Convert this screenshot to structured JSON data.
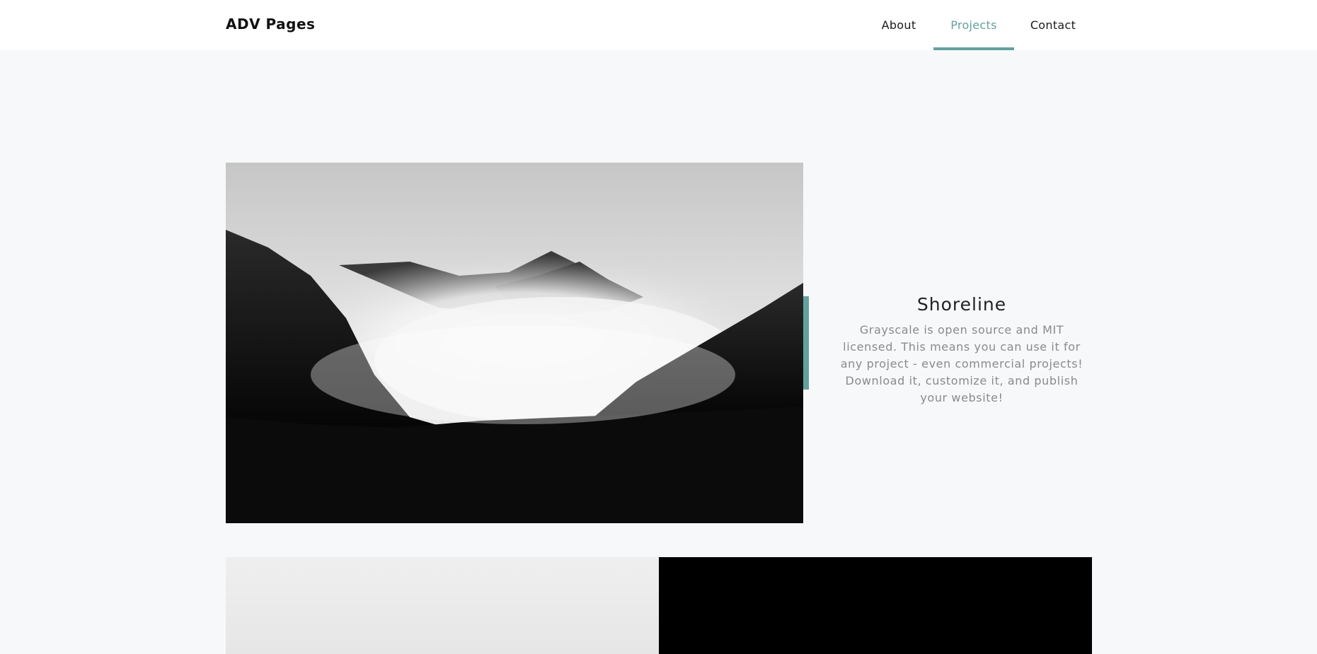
{
  "navbar": {
    "brand": "ADV Pages",
    "links": [
      {
        "label": "About",
        "active": false
      },
      {
        "label": "Projects",
        "active": true
      },
      {
        "label": "Contact",
        "active": false
      }
    ],
    "active_color": "#64a19d"
  },
  "project": {
    "title": "Shoreline",
    "description": "Grayscale is open source and MIT licensed. This means you can use it for any project - even commercial projects! Download it, customize it, and publish your website!",
    "image_icon": "misty-mountains-photo"
  },
  "gallery": {
    "left_tile_icon": "misty-sky-photo",
    "right_tile_icon": "dark-photo"
  },
  "colors": {
    "accent": "#64a19d",
    "page_background": "#f7f8fa",
    "navbar_background": "#ffffff"
  }
}
